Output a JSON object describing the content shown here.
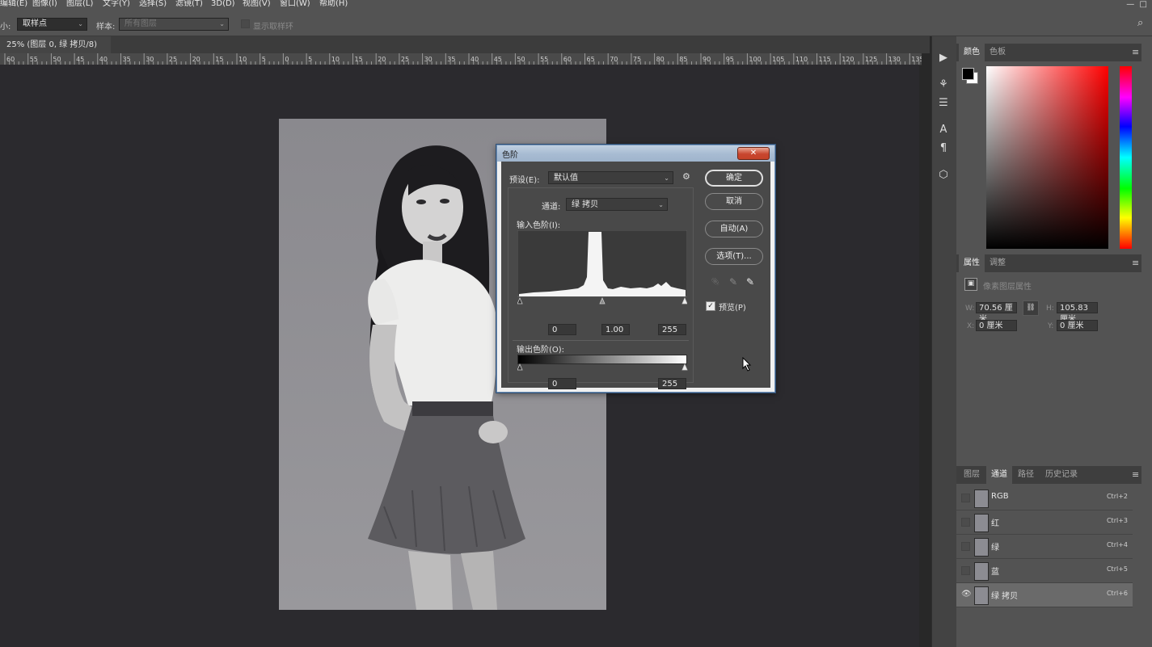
{
  "menu": [
    "编辑(E)",
    "图像(I)",
    "图层(L)",
    "文字(Y)",
    "选择(S)",
    "滤镜(T)",
    "3D(D)",
    "视图(V)",
    "窗口(W)",
    "帮助(H)"
  ],
  "options_bar": {
    "size_label": "小:",
    "size_value": "取样点",
    "sample_label": "样本:",
    "sample_value": "所有图层",
    "show_ring_label": "显示取样环"
  },
  "document_tab": {
    "title": "25% (图层 0, 绿 拷贝/8) *",
    "close": "×"
  },
  "ruler_labels": [
    "60",
    "55",
    "50",
    "45",
    "40",
    "35",
    "30",
    "25",
    "20",
    "15",
    "10",
    "5",
    "0",
    "5",
    "10",
    "15",
    "20",
    "25",
    "30",
    "35",
    "40",
    "45",
    "50",
    "55",
    "60",
    "65",
    "70",
    "75",
    "80",
    "85",
    "90",
    "95",
    "100",
    "105",
    "110",
    "115",
    "120",
    "125",
    "130",
    "135"
  ],
  "color_panel": {
    "tabs": [
      "颜色",
      "色板"
    ]
  },
  "properties_panel": {
    "tabs": [
      "属性",
      "调整"
    ],
    "section_title": "像素图层属性",
    "w_label": "W:",
    "w_value": "70.56 厘米",
    "h_label": "H:",
    "h_value": "105.83 厘米",
    "x_label": "X:",
    "x_value": "0 厘米",
    "y_label": "Y:",
    "y_value": "0 厘米"
  },
  "channels_panel": {
    "tabs": [
      "图层",
      "通道",
      "路径",
      "历史记录"
    ],
    "channels": [
      {
        "name": "RGB",
        "shortcut": "Ctrl+2"
      },
      {
        "name": "红",
        "shortcut": "Ctrl+3"
      },
      {
        "name": "绿",
        "shortcut": "Ctrl+4"
      },
      {
        "name": "蓝",
        "shortcut": "Ctrl+5"
      },
      {
        "name": "绿 拷贝",
        "shortcut": "Ctrl+6"
      }
    ]
  },
  "levels_dialog": {
    "title": "色阶",
    "close": "✕",
    "preset_label": "预设(E):",
    "preset_value": "默认值",
    "channel_label": "通道:",
    "channel_value": "绿 拷贝",
    "input_levels_label": "输入色阶(I):",
    "input_black": "0",
    "input_gamma": "1.00",
    "input_white": "255",
    "output_levels_label": "输出色阶(O):",
    "output_black": "0",
    "output_white": "255",
    "ok": "确定",
    "cancel": "取消",
    "auto": "自动(A)",
    "options": "选项(T)...",
    "preview_label": "预览(P)",
    "preview_checked": true
  }
}
